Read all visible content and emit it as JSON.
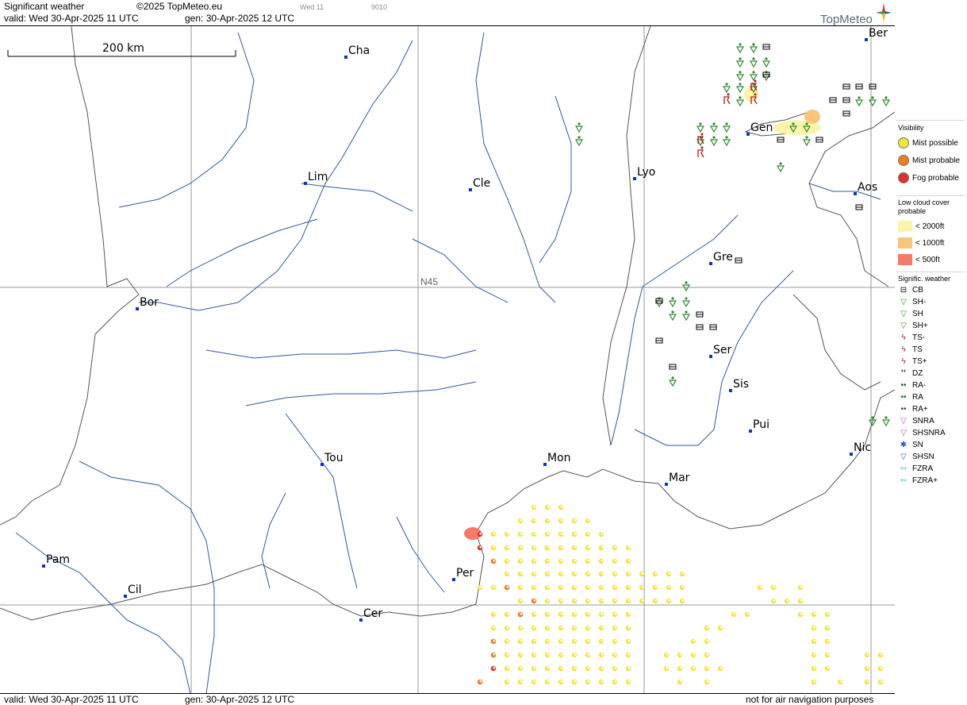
{
  "header": {
    "title": "Significant weather",
    "copyright": "©2025 TopMeteo.eu",
    "day_tag": "Wed 11",
    "code_tag": "9010",
    "valid": "valid:  Wed  30-Apr-2025  11 UTC",
    "generated": "gen:  30-Apr-2025  12 UTC",
    "brand": "TopMeteo"
  },
  "footer": {
    "valid": "valid:  Wed  30-Apr-2025  11 UTC",
    "generated": "gen:  30-Apr-2025  12 UTC",
    "disclaimer": "not for air navigation purposes"
  },
  "map": {
    "scale_label": "200 km",
    "lat_label": "N45",
    "cities": [
      {
        "name": "Cha"
      },
      {
        "name": "Ber"
      },
      {
        "name": "Lim"
      },
      {
        "name": "Cle"
      },
      {
        "name": "Lyo"
      },
      {
        "name": "Gen"
      },
      {
        "name": "Aos"
      },
      {
        "name": "Gre"
      },
      {
        "name": "Bor"
      },
      {
        "name": "Ser"
      },
      {
        "name": "Sis"
      },
      {
        "name": "Pui"
      },
      {
        "name": "Nic"
      },
      {
        "name": "Tou"
      },
      {
        "name": "Mon"
      },
      {
        "name": "Mar"
      },
      {
        "name": "Pam"
      },
      {
        "name": "Per"
      },
      {
        "name": "Cil"
      },
      {
        "name": "Cer"
      }
    ]
  },
  "legend": {
    "visibility_title": "Visibility",
    "visibility": [
      {
        "label": "Mist possible",
        "color": "#f5e43a"
      },
      {
        "label": "Mist probable",
        "color": "#f07a1e"
      },
      {
        "label": "Fog probable",
        "color": "#e03030"
      }
    ],
    "cloud_title": "Low cloud cover probable",
    "cloud": [
      {
        "label": "< 2000ft",
        "color": "#fbf4a8"
      },
      {
        "label": "< 1000ft",
        "color": "#f8c67a"
      },
      {
        "label": "<   500ft",
        "color": "#f57a6a"
      }
    ],
    "weather_title": "Signific. weather",
    "weather": [
      {
        "label": "CB",
        "icon": "cb-icon"
      },
      {
        "label": "SH-",
        "icon": "shower-light-icon"
      },
      {
        "label": "SH",
        "icon": "shower-icon"
      },
      {
        "label": "SH+",
        "icon": "shower-heavy-icon"
      },
      {
        "label": "TS-",
        "icon": "thunderstorm-light-icon"
      },
      {
        "label": "TS",
        "icon": "thunderstorm-icon"
      },
      {
        "label": "TS+",
        "icon": "thunderstorm-heavy-icon"
      },
      {
        "label": "DZ",
        "icon": "drizzle-icon"
      },
      {
        "label": "RA-",
        "icon": "rain-light-icon"
      },
      {
        "label": "RA",
        "icon": "rain-icon"
      },
      {
        "label": "RA+",
        "icon": "rain-heavy-icon"
      },
      {
        "label": "SNRA",
        "icon": "snow-rain-icon"
      },
      {
        "label": "SHSNRA",
        "icon": "snow-rain-shower-icon"
      },
      {
        "label": "SN",
        "icon": "snow-icon"
      },
      {
        "label": "SHSN",
        "icon": "snow-shower-icon"
      },
      {
        "label": "FZRA",
        "icon": "freezing-rain-icon"
      },
      {
        "label": "FZRA+",
        "icon": "freezing-rain-heavy-icon"
      }
    ]
  }
}
